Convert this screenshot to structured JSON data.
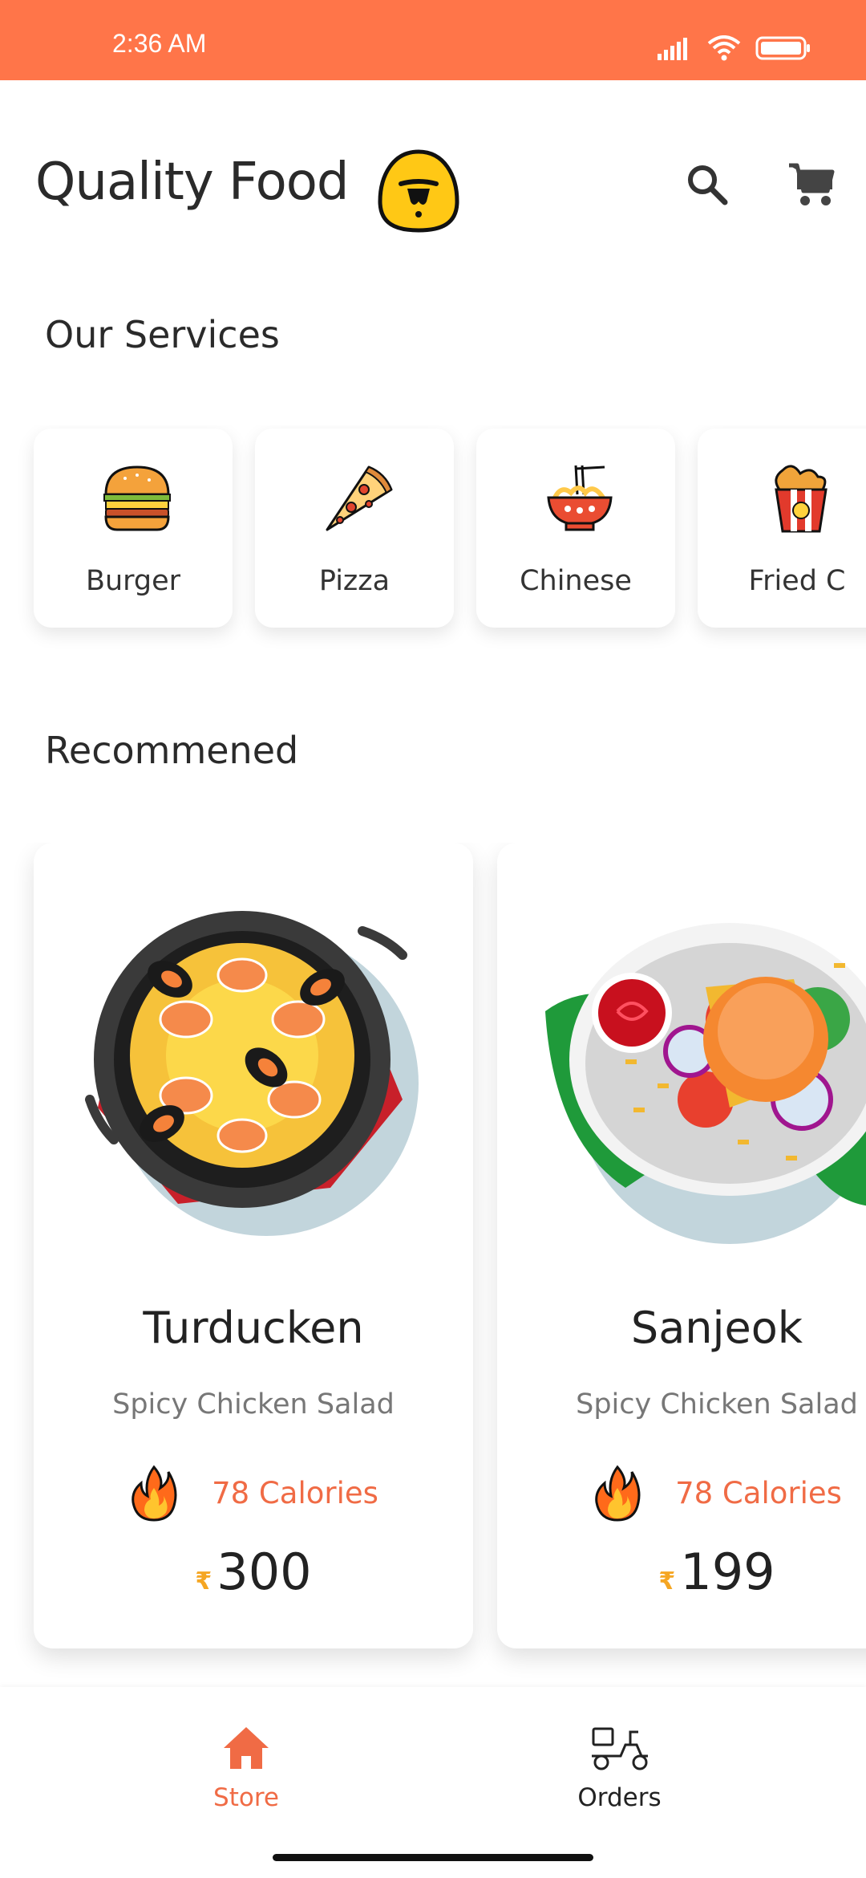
{
  "status_bar": {
    "time": "2:36 AM"
  },
  "header": {
    "title": "Quality Food"
  },
  "services": {
    "title": "Our Services",
    "items": [
      {
        "label": "Burger",
        "icon": "burger-icon"
      },
      {
        "label": "Pizza",
        "icon": "pizza-icon"
      },
      {
        "label": "Chinese",
        "icon": "noodles-icon"
      },
      {
        "label": "Fried C",
        "icon": "fried-chicken-icon"
      }
    ]
  },
  "recommended": {
    "title": "Recommened",
    "items": [
      {
        "name": "Turducken",
        "desc": "Spicy Chicken Salad",
        "calories": "78 Calories",
        "currency": "₹",
        "price": "300"
      },
      {
        "name": "Sanjeok",
        "desc": "Spicy Chicken Salad",
        "calories": "78 Calories",
        "currency": "₹",
        "price": "199"
      }
    ]
  },
  "nav": {
    "store": "Store",
    "orders": "Orders"
  },
  "colors": {
    "accent": "#ff7549",
    "calorie": "#f06b45",
    "rupee": "#f5a623"
  }
}
